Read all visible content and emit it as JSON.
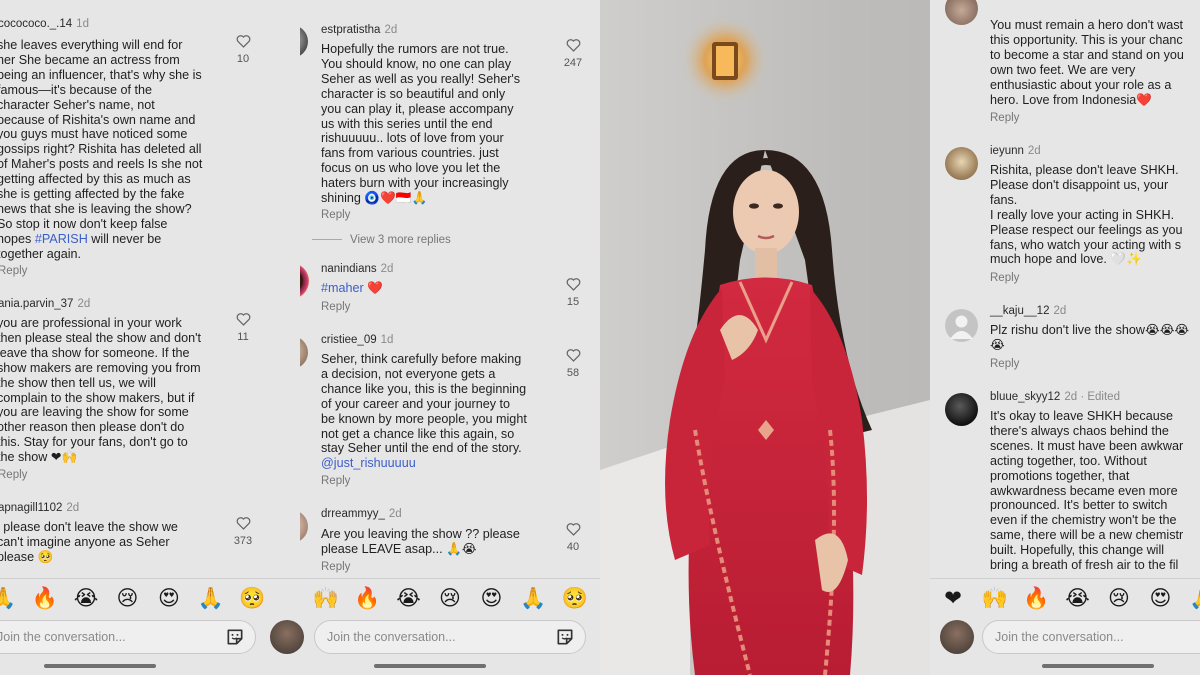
{
  "panel_a": {
    "comments": [
      {
        "user": "cocococo._.14",
        "ago": "1d",
        "text": "she leaves everything will end for\nher She became an actress from\nbeing an influencer, that's why she is\nfamous—it's because of the\ncharacter Seher's name, not\nbecause of Rishita's own name and\nyou guys must have noticed some\ngossips right? Rishita has deleted all\nof Maher's posts and reels Is she not\ngetting affected by this as much as\nshe is getting affected by the fake\nnews that she is leaving the show?\nSo stop it now don't keep false\nhopes",
        "tag": "#PARISH",
        "text_after": " will never be\ntogether again.",
        "reply": "Reply",
        "likes": "10"
      },
      {
        "user": "ania.parvin_37",
        "ago": "2d",
        "text": "you are professional in your work\nthen please steal the show and don't\nleave tha show for someone.  If the\nshow makers are removing you from\nthe show then tell us, we will\ncomplain to the show makers, but if\nyou are leaving the show for some\nother reason then please don't do\nthis. Stay for your fans, don't go to\nthe show ❤🙌",
        "reply": "Reply",
        "likes": "11"
      },
      {
        "user": "apnagill1102",
        "ago": "2d",
        "text": "i please don't leave the show we\ncan't imagine anyone as Seher\nplease 🥺",
        "likes": "373"
      }
    ],
    "emojis": [
      "🙏",
      "🔥",
      "😭",
      "😢",
      "😍",
      "🙏",
      "🥺",
      "❤",
      "🙌",
      "🔥",
      "😭",
      "😢",
      "😍",
      "🙏",
      "🥺"
    ],
    "input_placeholder": "Join the conversation..."
  },
  "panel_b": {
    "comments": [
      {
        "user": "estpratistha",
        "ago": "2d",
        "text": "Hopefully the rumors are not true.\nYou should know, no one can play\nSeher as well as you really! Seher's\ncharacter is so beautiful and only\nyou can play it, please accompany\nus with this series until the end\nrishuuuuu.. lots of love from your\nfans from various countries. just\nfocus on us who love you let the\nhaters burn with your increasingly\nshining 🧿❤️🇮🇩🙏",
        "reply": "Reply",
        "likes": "247"
      },
      {
        "user": "nanindians",
        "ago": "2d",
        "tag": "#maher",
        "text_after": " ❤️",
        "reply": "Reply",
        "likes": "15"
      },
      {
        "user": "cristiee_09",
        "ago": "1d",
        "text": "Seher, think carefully before making\na decision, not everyone gets a\nchance like you, this is the beginning\nof your career and your journey to\nbe known by more people, you might\nnot get a chance like this again, so\nstay Seher until the end of the story.",
        "tag": "@just_rishuuuuu",
        "reply": "Reply",
        "likes": "58"
      },
      {
        "user": "drreammyy_",
        "ago": "2d",
        "text": "Are you leaving the show ?? please\nplease LEAVE asap... 🙏😭",
        "reply": "Reply",
        "likes": "40"
      }
    ],
    "view_more": "View 3 more replies",
    "input_placeholder": "Join the conversation..."
  },
  "panel_c": {
    "comments": [
      {
        "text": "You must remain a hero don't wast\nthis opportunity. This is your chanc\nto become a star and stand on you\nown two feet. We are very\nenthusiastic about your role as a\nhero. Love from Indonesia❤️",
        "reply": "Reply"
      },
      {
        "user": "ieyunn",
        "ago": "2d",
        "text": "Rishita, please don't leave SHKH.\nPlease don't disappoint us, your\nfans.\nI really love your acting in SHKH.\nPlease respect our feelings as you\nfans, who watch your acting with s\nmuch hope and love. 🤍✨",
        "reply": "Reply"
      },
      {
        "user": "__kaju__12",
        "ago": "2d",
        "text": "Plz rishu don't live the show😭😭😭\n😭",
        "reply": "Reply"
      },
      {
        "user": "bluue_skyy12",
        "ago": "2d",
        "edited": "· Edited",
        "text": "It's okay to leave SHKH because\nthere's always chaos behind the\nscenes. It must have been awkwar\nacting together, too. Without\npromotions together, that\nawkwardness became even more\npronounced. It's better to switch\neven if the chemistry won't be the\nsame, there will be a new chemistr\nbuilt. Hopefully, this change will\nbring a breath of fresh air to the fil"
      }
    ],
    "emojis": [
      "❤",
      "🙌",
      "🔥",
      "😭",
      "😢",
      "😍",
      "🙏"
    ],
    "input_placeholder": "Join the conversation..."
  },
  "colors": {
    "panel_bg": "#e6e6e6",
    "tag": "#3c5ec9",
    "dress": "#c8243a",
    "heart_red": "#e0245e"
  }
}
